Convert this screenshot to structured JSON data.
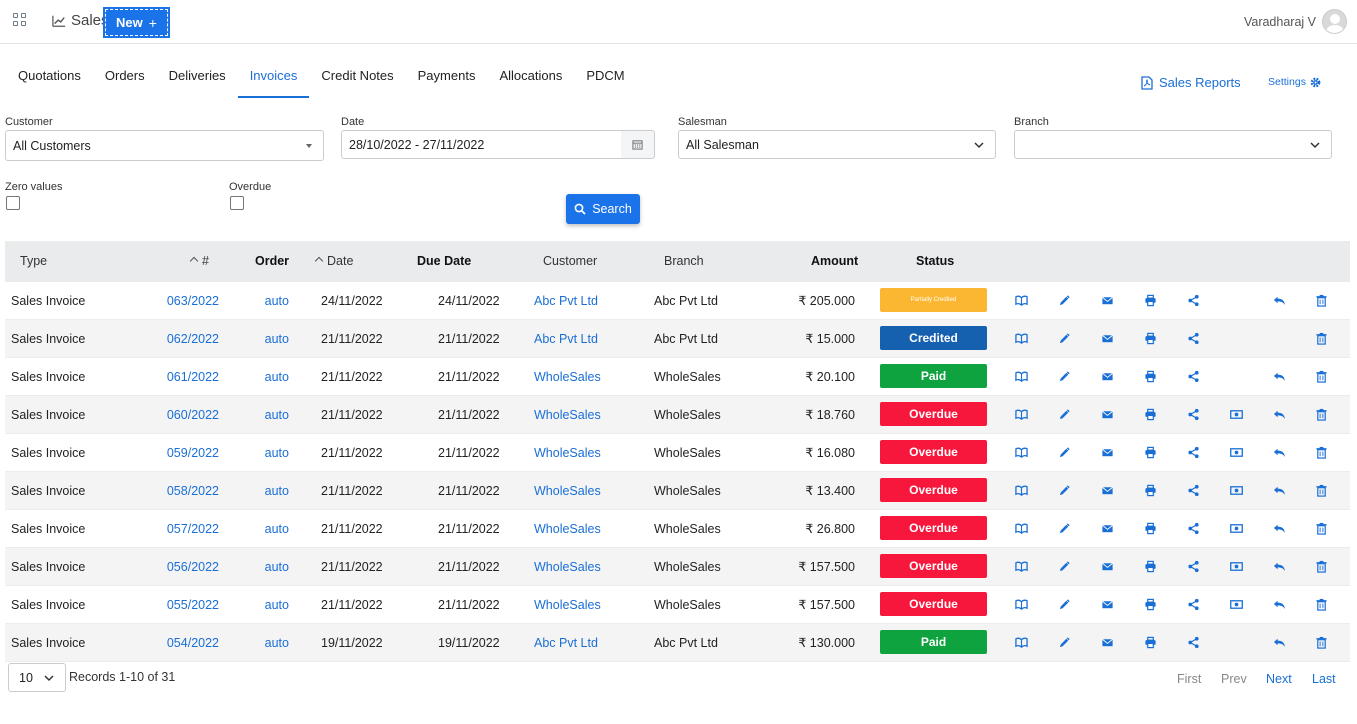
{
  "app": {
    "name": "Sales",
    "new_label": "New"
  },
  "user": {
    "name": "Varadharaj V"
  },
  "tabs": [
    {
      "label": "Quotations",
      "active": false
    },
    {
      "label": "Orders",
      "active": false
    },
    {
      "label": "Deliveries",
      "active": false
    },
    {
      "label": "Invoices",
      "active": true
    },
    {
      "label": "Credit Notes",
      "active": false
    },
    {
      "label": "Payments",
      "active": false
    },
    {
      "label": "Allocations",
      "active": false
    },
    {
      "label": "PDCM",
      "active": false
    }
  ],
  "links": {
    "sales_reports": "Sales Reports",
    "settings": "Settings"
  },
  "filters": {
    "customer": {
      "label": "Customer",
      "value": "All Customers"
    },
    "date": {
      "label": "Date",
      "value": "28/10/2022 - 27/11/2022"
    },
    "salesman": {
      "label": "Salesman",
      "value": "All Salesman"
    },
    "branch": {
      "label": "Branch",
      "value": ""
    },
    "zero_values": {
      "label": "Zero values",
      "checked": false
    },
    "overdue": {
      "label": "Overdue",
      "checked": false
    },
    "search_label": "Search"
  },
  "table": {
    "headers": {
      "type": "Type",
      "number": "#",
      "order": "Order",
      "date": "Date",
      "due_date": "Due Date",
      "customer": "Customer",
      "branch": "Branch",
      "amount": "Amount",
      "status": "Status"
    },
    "rows": [
      {
        "type": "Sales Invoice",
        "number": "063/2022",
        "order": "auto",
        "date": "24/11/2022",
        "due": "24/11/2022",
        "customer": "Abc Pvt Ltd",
        "branch": "Abc Pvt Ltd",
        "amount": "₹ 205.000",
        "status": "Partially Credited",
        "payment": false,
        "reverse": true
      },
      {
        "type": "Sales Invoice",
        "number": "062/2022",
        "order": "auto",
        "date": "21/11/2022",
        "due": "21/11/2022",
        "customer": "Abc Pvt Ltd",
        "branch": "Abc Pvt Ltd",
        "amount": "₹ 15.000",
        "status": "Credited",
        "payment": false,
        "reverse": false
      },
      {
        "type": "Sales Invoice",
        "number": "061/2022",
        "order": "auto",
        "date": "21/11/2022",
        "due": "21/11/2022",
        "customer": "WholeSales",
        "branch": "WholeSales",
        "amount": "₹ 20.100",
        "status": "Paid",
        "payment": false,
        "reverse": true
      },
      {
        "type": "Sales Invoice",
        "number": "060/2022",
        "order": "auto",
        "date": "21/11/2022",
        "due": "21/11/2022",
        "customer": "WholeSales",
        "branch": "WholeSales",
        "amount": "₹ 18.760",
        "status": "Overdue",
        "payment": true,
        "reverse": true
      },
      {
        "type": "Sales Invoice",
        "number": "059/2022",
        "order": "auto",
        "date": "21/11/2022",
        "due": "21/11/2022",
        "customer": "WholeSales",
        "branch": "WholeSales",
        "amount": "₹ 16.080",
        "status": "Overdue",
        "payment": true,
        "reverse": true
      },
      {
        "type": "Sales Invoice",
        "number": "058/2022",
        "order": "auto",
        "date": "21/11/2022",
        "due": "21/11/2022",
        "customer": "WholeSales",
        "branch": "WholeSales",
        "amount": "₹ 13.400",
        "status": "Overdue",
        "payment": true,
        "reverse": true
      },
      {
        "type": "Sales Invoice",
        "number": "057/2022",
        "order": "auto",
        "date": "21/11/2022",
        "due": "21/11/2022",
        "customer": "WholeSales",
        "branch": "WholeSales",
        "amount": "₹ 26.800",
        "status": "Overdue",
        "payment": true,
        "reverse": true
      },
      {
        "type": "Sales Invoice",
        "number": "056/2022",
        "order": "auto",
        "date": "21/11/2022",
        "due": "21/11/2022",
        "customer": "WholeSales",
        "branch": "WholeSales",
        "amount": "₹ 157.500",
        "status": "Overdue",
        "payment": true,
        "reverse": true
      },
      {
        "type": "Sales Invoice",
        "number": "055/2022",
        "order": "auto",
        "date": "21/11/2022",
        "due": "21/11/2022",
        "customer": "WholeSales",
        "branch": "WholeSales",
        "amount": "₹ 157.500",
        "status": "Overdue",
        "payment": true,
        "reverse": true
      },
      {
        "type": "Sales Invoice",
        "number": "054/2022",
        "order": "auto",
        "date": "19/11/2022",
        "due": "19/11/2022",
        "customer": "Abc Pvt Ltd",
        "branch": "Abc Pvt Ltd",
        "amount": "₹ 130.000",
        "status": "Paid",
        "payment": false,
        "reverse": true
      }
    ]
  },
  "status_colors": {
    "Partially Credited": "#fbb732",
    "Credited": "#1660b0",
    "Paid": "#0fa33f",
    "Overdue": "#f8173c"
  },
  "icons": [
    "view-icon",
    "edit-icon",
    "email-icon",
    "print-icon",
    "share-icon",
    "payment-icon",
    "reverse-icon",
    "delete-icon"
  ],
  "pagination": {
    "page_size": "10",
    "records": "Records 1-10 of 31",
    "first": "First",
    "prev": "Prev",
    "next": "Next",
    "last": "Last"
  },
  "colors": {
    "primary": "#1a73e8",
    "link": "#1a6fd6",
    "header_bg": "#e9ebed"
  }
}
